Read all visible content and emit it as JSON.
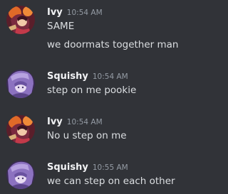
{
  "messages": [
    {
      "username": "Ivy",
      "timestamp": "10:54 AM",
      "lines": [
        "SAME",
        "we doormats together man"
      ]
    },
    {
      "username": "Squishy",
      "timestamp": "10:54 AM",
      "lines": [
        "step on me pookie"
      ]
    },
    {
      "username": "Ivy",
      "timestamp": "10:54 AM",
      "lines": [
        "No u step on me"
      ]
    },
    {
      "username": "Squishy",
      "timestamp": "10:55 AM",
      "lines": [
        "we can step on each other"
      ]
    }
  ],
  "colors": {
    "background": "#313338",
    "username": "#f2f3f5",
    "timestamp": "#949ba4",
    "text": "#dbdee1"
  }
}
